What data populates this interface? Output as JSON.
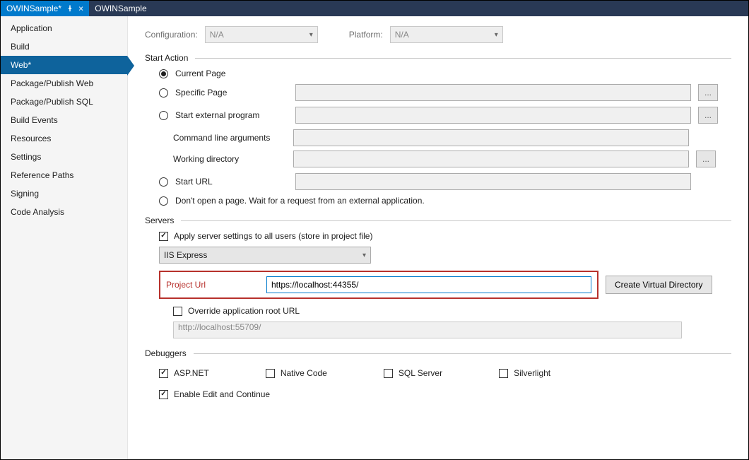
{
  "tabs": [
    {
      "label": "OWINSample*",
      "active": true
    },
    {
      "label": "OWINSample",
      "active": false
    }
  ],
  "sidebar": {
    "items": [
      "Application",
      "Build",
      "Web*",
      "Package/Publish Web",
      "Package/Publish SQL",
      "Build Events",
      "Resources",
      "Settings",
      "Reference Paths",
      "Signing",
      "Code Analysis"
    ],
    "selectedIndex": 2
  },
  "header": {
    "configuration_label": "Configuration:",
    "configuration_value": "N/A",
    "platform_label": "Platform:",
    "platform_value": "N/A"
  },
  "sections": {
    "start_action": "Start Action",
    "servers": "Servers",
    "debuggers": "Debuggers"
  },
  "start_action": {
    "current_page": "Current Page",
    "specific_page": "Specific Page",
    "start_external": "Start external program",
    "cmd_args": "Command line arguments",
    "working_dir": "Working directory",
    "start_url": "Start URL",
    "no_page": "Don't open a page.  Wait for a request from an external application.",
    "ellipsis": "..."
  },
  "servers": {
    "apply_all": "Apply server settings to all users (store in project file)",
    "server_type": "IIS Express",
    "project_url_label": "Project Url",
    "project_url_value": "https://localhost:44355/",
    "create_vdir": "Create Virtual Directory",
    "override_root": "Override application root URL",
    "root_url": "http://localhost:55709/"
  },
  "debuggers": {
    "aspnet": "ASP.NET",
    "native": "Native Code",
    "sql": "SQL Server",
    "silverlight": "Silverlight",
    "edit_continue": "Enable Edit and Continue"
  }
}
